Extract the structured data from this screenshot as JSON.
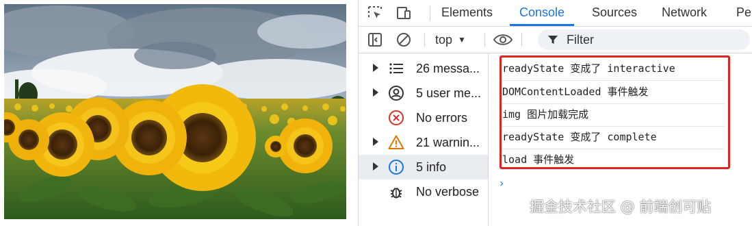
{
  "devtools": {
    "tabs": [
      "Elements",
      "Console",
      "Sources",
      "Network",
      "Per"
    ],
    "active_tab": "Console",
    "toolbar": {
      "context": "top",
      "filter_placeholder": "Filter"
    },
    "sidebar": [
      {
        "label": "26 messa...",
        "icon": "list-icon",
        "expandable": true
      },
      {
        "label": "5 user me...",
        "icon": "user-icon",
        "expandable": true
      },
      {
        "label": "No errors",
        "icon": "error-icon",
        "expandable": false
      },
      {
        "label": "21 warnin...",
        "icon": "warning-icon",
        "expandable": true
      },
      {
        "label": "5 info",
        "icon": "info-icon",
        "expandable": true,
        "selected": true
      },
      {
        "label": "No verbose",
        "icon": "bug-icon",
        "expandable": false
      }
    ],
    "log_lines": [
      {
        "code": "readyState ",
        "cn": "变成了",
        "code2": " interactive"
      },
      {
        "code": "DOMContentLoaded ",
        "cn": "事件触发",
        "code2": ""
      },
      {
        "code": "img ",
        "cn": "图片加载完成",
        "code2": ""
      },
      {
        "code": "readyState ",
        "cn": "变成了",
        "code2": " complete"
      },
      {
        "code": "load ",
        "cn": "事件触发",
        "code2": ""
      }
    ],
    "prompt_glyph": "›"
  },
  "watermark": "掘金技术社区 @ 前端创可贴",
  "colors": {
    "accent": "#1a73e8",
    "highlight_border": "#e02424",
    "error_red": "#d93025",
    "warning_orange": "#e37400"
  }
}
